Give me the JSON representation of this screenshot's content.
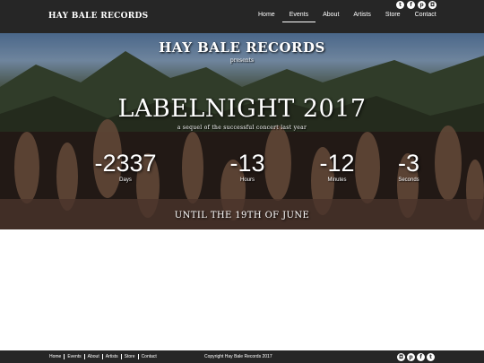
{
  "header": {
    "logo": "HAY BALE RECORDS",
    "nav": [
      "Home",
      "Events",
      "About",
      "Artists",
      "Store",
      "Contact"
    ],
    "active_nav": "Events",
    "social_icons": [
      "twitter-icon",
      "facebook-icon",
      "pinterest-icon",
      "instagram-icon"
    ]
  },
  "hero": {
    "brand": "HAY BALE RECORDS",
    "presents": "presents",
    "title": "LABELNIGHT 2017",
    "subtitle": "a sequel of the successful concert last year",
    "countdown": [
      {
        "value": "-2337",
        "label": "Days"
      },
      {
        "value": "-13",
        "label": "Hours"
      },
      {
        "value": "-12",
        "label": "Minutes"
      },
      {
        "value": "-3",
        "label": "Seconds"
      }
    ],
    "until": "UNTIL THE 19TH OF JUNE"
  },
  "footer": {
    "nav": [
      "Home",
      "Events",
      "About",
      "Artists",
      "Store",
      "Contact"
    ],
    "copyright": "Copyright Hay Bale Records 2017",
    "social_icons": [
      "instagram-icon",
      "pinterest-icon",
      "facebook-icon",
      "twitter-icon"
    ]
  }
}
